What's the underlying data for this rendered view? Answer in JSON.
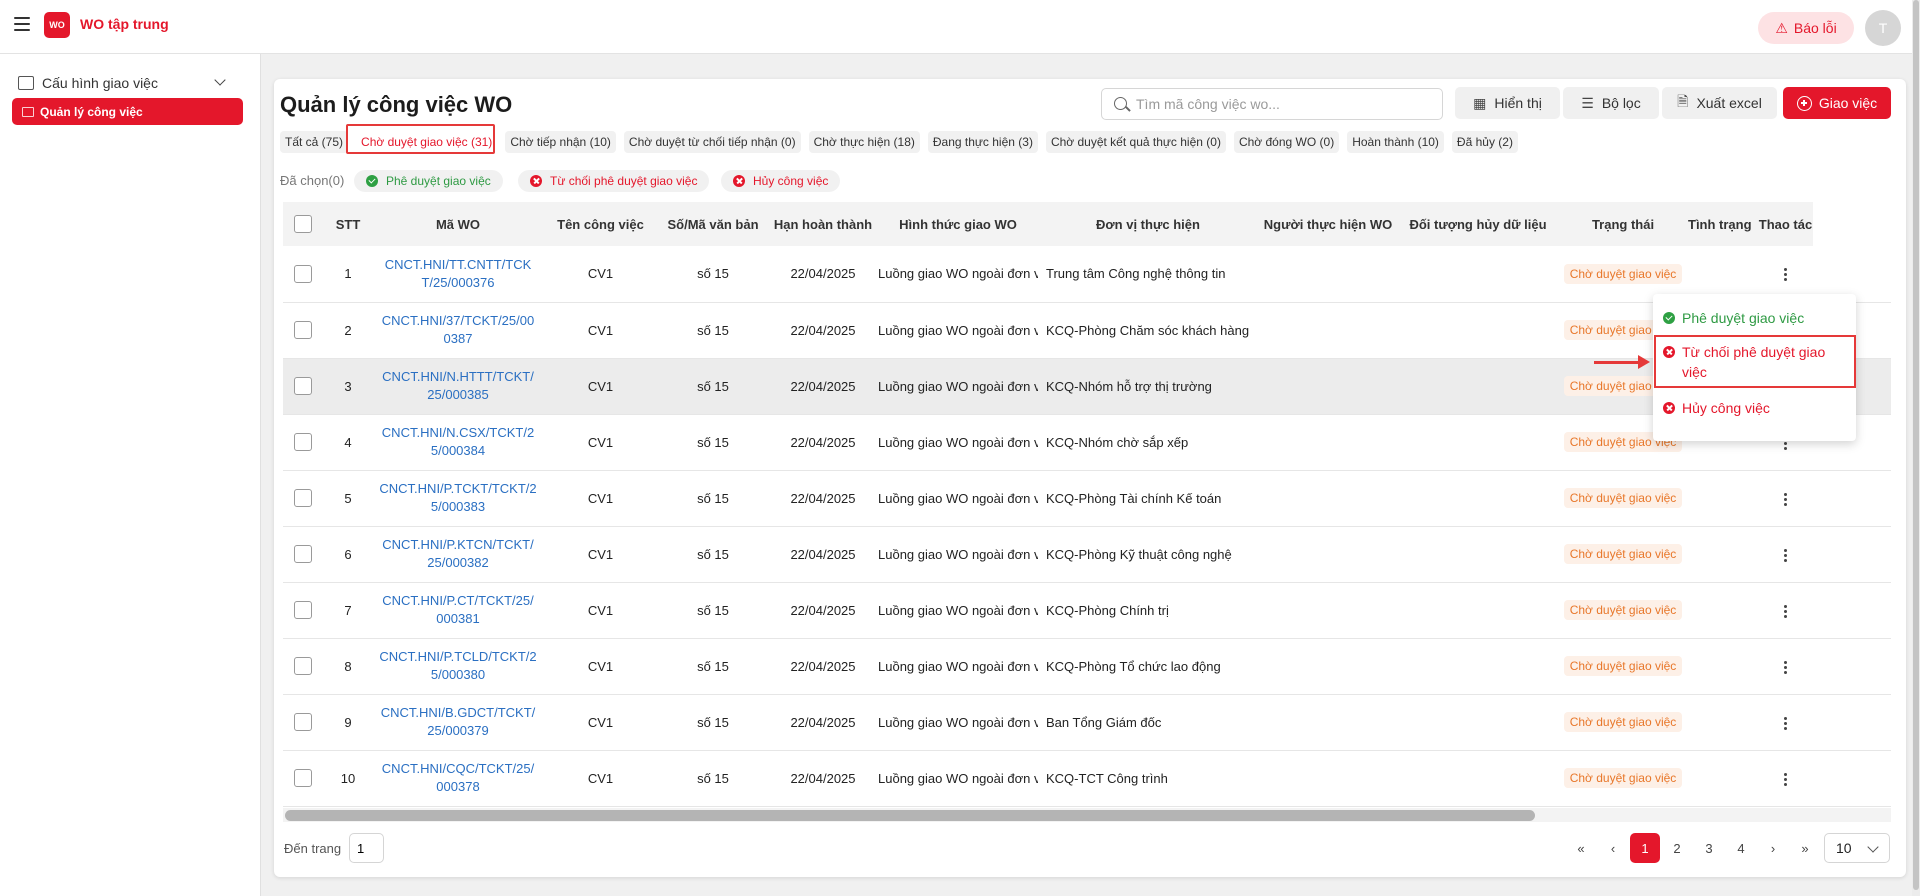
{
  "app": {
    "title": "WO tập trung",
    "logo_text": "WO",
    "report_label": "Báo lỗi",
    "avatar_initial": "T"
  },
  "sidebar": {
    "group_label": "Cấu hình giao việc",
    "active_item": "Quản lý công việc"
  },
  "page": {
    "title": "Quản lý công việc WO"
  },
  "toolbar": {
    "search_placeholder": "Tìm mã công việc wo...",
    "display_label": "Hiển thị",
    "filter_label": "Bộ lọc",
    "export_label": "Xuất excel",
    "assign_label": "Giao việc"
  },
  "tabs": [
    "Tất cả (75)",
    "Chờ duyệt giao việc (31)",
    "Chờ tiếp nhận (10)",
    "Chờ duyệt từ chối tiếp nhận (0)",
    "Chờ thực hiện (18)",
    "Đang thực hiện (3)",
    "Chờ duyệt kết quả thực hiện (0)",
    "Chờ đóng WO (0)",
    "Hoàn thành (10)",
    "Đã hủy (2)"
  ],
  "bulk": {
    "selected_label": "Đã chọn(0)",
    "approve": "Phê duyệt giao việc",
    "reject": "Từ chối phê duyệt giao việc",
    "cancel": "Hủy công việc"
  },
  "table": {
    "columns": [
      "STT",
      "Mã WO",
      "Tên công việc",
      "Số/Mã văn bản",
      "Hạn hoàn thành",
      "Hình thức giao WO",
      "Đơn vị thực hiện",
      "Người thực hiện WO",
      "Đối tượng hủy dữ liệu",
      "Trạng thái",
      "Tình trạng",
      "Thao tác"
    ],
    "rows": [
      {
        "stt": "1",
        "code": "CNCT.HNI/TT.CNTT/TCKT/25/000376",
        "name": "CV1",
        "doc": "số 15",
        "due": "22/04/2025",
        "mode": "Luồng giao WO ngoài đơn vị",
        "unit": "Trung tâm Công nghệ thông tin",
        "status": "Chờ duyệt giao việc"
      },
      {
        "stt": "2",
        "code": "CNCT.HNI/37/TCKT/25/000387",
        "name": "CV1",
        "doc": "số 15",
        "due": "22/04/2025",
        "mode": "Luồng giao WO ngoài đơn vị",
        "unit": "KCQ-Phòng Chăm sóc khách hàng",
        "status": "Chờ duyệt giao việc"
      },
      {
        "stt": "3",
        "code": "CNCT.HNI/N.HTTT/TCKT/25/000385",
        "name": "CV1",
        "doc": "số 15",
        "due": "22/04/2025",
        "mode": "Luồng giao WO ngoài đơn vị",
        "unit": "KCQ-Nhóm hỗ trợ thị trường",
        "status": "Chờ duyệt giao việc"
      },
      {
        "stt": "4",
        "code": "CNCT.HNI/N.CSX/TCKT/25/000384",
        "name": "CV1",
        "doc": "số 15",
        "due": "22/04/2025",
        "mode": "Luồng giao WO ngoài đơn vị",
        "unit": "KCQ-Nhóm chờ sắp xếp",
        "status": "Chờ duyệt giao việc"
      },
      {
        "stt": "5",
        "code": "CNCT.HNI/P.TCKT/TCKT/25/000383",
        "name": "CV1",
        "doc": "số 15",
        "due": "22/04/2025",
        "mode": "Luồng giao WO ngoài đơn vị",
        "unit": "KCQ-Phòng Tài chính Kế toán",
        "status": "Chờ duyệt giao việc"
      },
      {
        "stt": "6",
        "code": "CNCT.HNI/P.KTCN/TCKT/25/000382",
        "name": "CV1",
        "doc": "số 15",
        "due": "22/04/2025",
        "mode": "Luồng giao WO ngoài đơn vị",
        "unit": "KCQ-Phòng Kỹ thuật công nghệ",
        "status": "Chờ duyệt giao việc"
      },
      {
        "stt": "7",
        "code": "CNCT.HNI/P.CT/TCKT/25/000381",
        "name": "CV1",
        "doc": "số 15",
        "due": "22/04/2025",
        "mode": "Luồng giao WO ngoài đơn vị",
        "unit": "KCQ-Phòng Chính trị",
        "status": "Chờ duyệt giao việc"
      },
      {
        "stt": "8",
        "code": "CNCT.HNI/P.TCLD/TCKT/25/000380",
        "name": "CV1",
        "doc": "số 15",
        "due": "22/04/2025",
        "mode": "Luồng giao WO ngoài đơn vị",
        "unit": "KCQ-Phòng Tổ chức lao động",
        "status": "Chờ duyệt giao việc"
      },
      {
        "stt": "9",
        "code": "CNCT.HNI/B.GDCT/TCKT/25/000379",
        "name": "CV1",
        "doc": "số 15",
        "due": "22/04/2025",
        "mode": "Luồng giao WO ngoài đơn vị",
        "unit": "Ban Tổng Giám đốc",
        "status": "Chờ duyệt giao việc"
      },
      {
        "stt": "10",
        "code": "CNCT.HNI/CQC/TCKT/25/000378",
        "name": "CV1",
        "doc": "số 15",
        "due": "22/04/2025",
        "mode": "Luồng giao WO ngoài đơn vị",
        "unit": "KCQ-TCT Công trình",
        "status": "Chờ duyệt giao việc"
      }
    ]
  },
  "row_menu": {
    "approve": "Phê duyệt giao việc",
    "reject": "Từ chối phê duyệt giao việc",
    "cancel": "Hủy công việc"
  },
  "pagination": {
    "goto_label": "Đến trang",
    "goto_value": "1",
    "pages": [
      "1",
      "2",
      "3",
      "4"
    ],
    "current": "1",
    "page_size": "10"
  },
  "colors": {
    "brand": "#e4172b",
    "status_text": "#e8772a",
    "link": "#2a6fc2",
    "success": "#2e9a43"
  }
}
